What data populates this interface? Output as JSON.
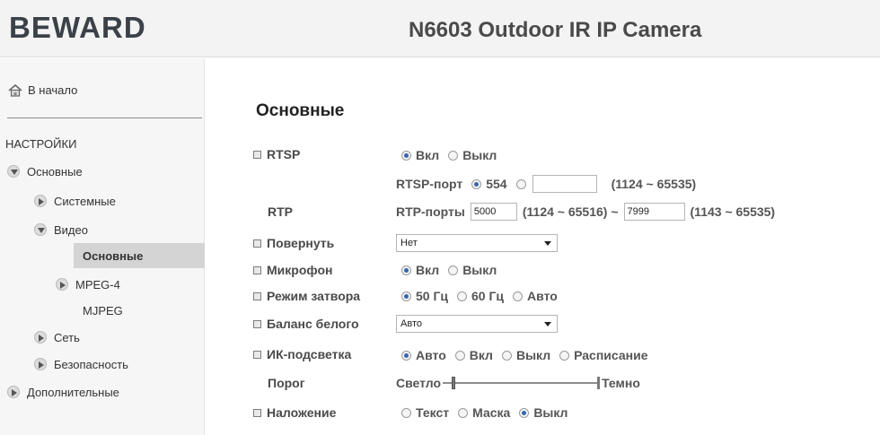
{
  "header": {
    "logo": "BEWARD",
    "title": "N6603 Outdoor IR IP Camera"
  },
  "sidebar": {
    "home": "В начало",
    "section": "НАСТРОЙКИ",
    "items": {
      "basic": "Основные",
      "system": "Системные",
      "video": "Видео",
      "video_basic": "Основные",
      "mpeg4": "MPEG-4",
      "mjpeg": "MJPEG",
      "network": "Сеть",
      "security": "Безопасность",
      "advanced": "Дополнительные"
    }
  },
  "main": {
    "title": "Основные",
    "rtsp": {
      "label": "RTSP",
      "on": "Вкл",
      "off": "Выкл",
      "selected": "on",
      "port_label": "RTSP-порт",
      "port_default": "554",
      "port_custom_value": "",
      "port_range": "(1124 ~ 65535)"
    },
    "rtp": {
      "label": "RTP",
      "ports_label": "RTP-порты",
      "port_start": "5000",
      "range1": "(1124 ~ 65516) ~",
      "port_end": "7999",
      "range2": "(1143 ~ 65535)"
    },
    "rotate": {
      "label": "Повернуть",
      "value": "Нет"
    },
    "microphone": {
      "label": "Микрофон",
      "on": "Вкл",
      "off": "Выкл",
      "selected": "on"
    },
    "shutter": {
      "label": "Режим затвора",
      "opt50": "50 Гц",
      "opt60": "60 Гц",
      "auto": "Авто",
      "selected": "50"
    },
    "white_balance": {
      "label": "Баланс белого",
      "value": "Авто"
    },
    "ir": {
      "label": "ИК-подсветка",
      "auto": "Авто",
      "on": "Вкл",
      "off": "Выкл",
      "schedule": "Расписание",
      "selected": "auto"
    },
    "threshold": {
      "label": "Порог",
      "left": "Светло",
      "right": "Темно",
      "level": 0.06
    },
    "overlay": {
      "label": "Наложение",
      "text": "Текст",
      "mask": "Маска",
      "off": "Выкл",
      "selected": "off"
    }
  }
}
